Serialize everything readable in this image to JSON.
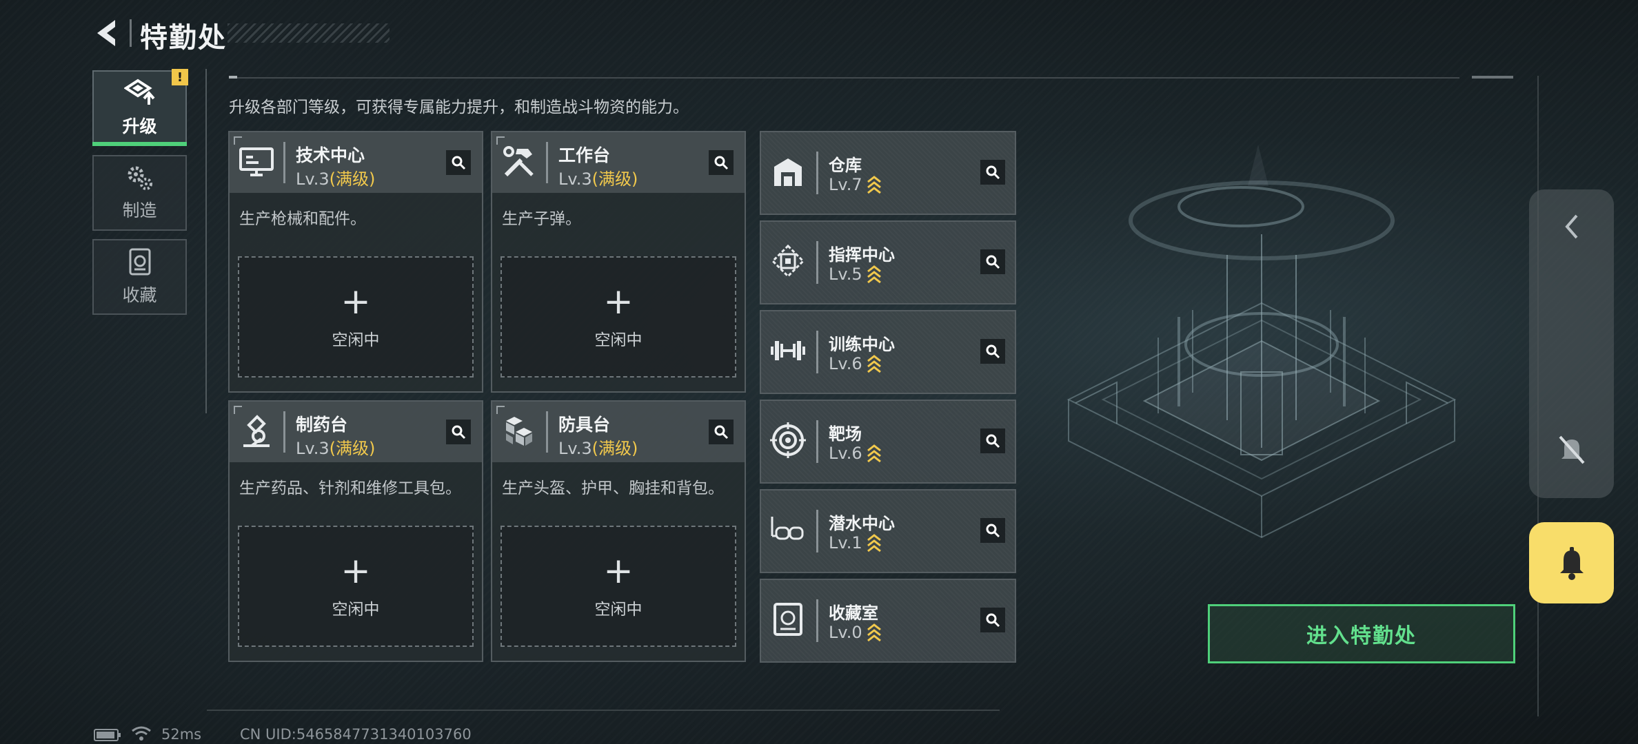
{
  "header": {
    "title": "特勤处"
  },
  "nav": [
    {
      "label": "升级",
      "icon": "upgrade-icon",
      "active": true,
      "badge": "!"
    },
    {
      "label": "制造",
      "icon": "gears-icon",
      "active": false
    },
    {
      "label": "收藏",
      "icon": "collection-icon",
      "active": false
    }
  ],
  "intro": "升级各部门等级，可获得专属能力提升，和制造战斗物资的能力。",
  "production": [
    {
      "name": "技术中心",
      "level": "Lv.3",
      "max": "(满级)",
      "desc": "生产枪械和配件。",
      "slot_label": "空闲中",
      "icon": "computer-icon"
    },
    {
      "name": "工作台",
      "level": "Lv.3",
      "max": "(满级)",
      "desc": "生产子弹。",
      "slot_label": "空闲中",
      "icon": "tools-icon"
    },
    {
      "name": "制药台",
      "level": "Lv.3",
      "max": "(满级)",
      "desc": "生产药品、针剂和维修工具包。",
      "slot_label": "空闲中",
      "icon": "microscope-icon"
    },
    {
      "name": "防具台",
      "level": "Lv.3",
      "max": "(满级)",
      "desc": "生产头盔、护甲、胸挂和背包。",
      "slot_label": "空闲中",
      "icon": "armor-blocks-icon"
    }
  ],
  "slot_plus": "+",
  "facilities": [
    {
      "name": "仓库",
      "level": "Lv.7",
      "icon": "warehouse-icon"
    },
    {
      "name": "指挥中心",
      "level": "Lv.5",
      "icon": "command-chip-icon"
    },
    {
      "name": "训练中心",
      "level": "Lv.6",
      "icon": "dumbbell-icon"
    },
    {
      "name": "靶场",
      "level": "Lv.6",
      "icon": "target-icon"
    },
    {
      "name": "潜水中心",
      "level": "Lv.1",
      "icon": "diving-mask-icon"
    },
    {
      "name": "收藏室",
      "level": "Lv.0",
      "icon": "collection-room-icon"
    }
  ],
  "enter_button": "进入特勤处",
  "status": {
    "ping": "52ms",
    "uid": "CN UID:5465847731340103760"
  },
  "colors": {
    "accent_green": "#4fd07a",
    "max_level_gold": "#f2c94c",
    "warning_yellow": "#f1c64a",
    "bell_yellow": "#f8dd6a"
  }
}
